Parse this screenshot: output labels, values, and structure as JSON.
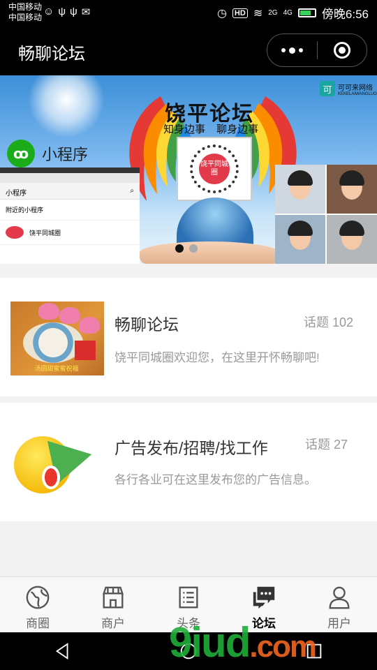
{
  "status_bar": {
    "carrier_1": "中国移动",
    "carrier_2": "中国移动",
    "hd": "HD",
    "signal_1": "2G",
    "signal_2": "4G",
    "time": "傍晚6:56"
  },
  "nav_bar": {
    "title": "畅聊论坛"
  },
  "banner": {
    "mini_program_label": "小程序",
    "title": "饶平论坛",
    "subtitle": "知身边事 聊身边事",
    "qr_center": "饶平同城圈",
    "brand": "可可来网络",
    "brand_sub": "KEKELAIWANGLUO",
    "phone": {
      "header": "小程序",
      "row_1": "附近的小程序",
      "row_2": "饶平同城圈"
    },
    "active_indicator": 0,
    "indicator_count": 2
  },
  "forums": [
    {
      "title": "畅聊论坛",
      "count": "话题 102",
      "description": "饶平同城圈欢迎您，在这里开怀畅聊吧!",
      "thumb_caption": "汤圆甜蜜蜜祝福"
    },
    {
      "title": "广告发布/招聘/找工作",
      "count": "话题 27",
      "description": "各行各业可在这里发布您的广告信息。"
    }
  ],
  "tabs": [
    {
      "label": "商圈",
      "icon": "globe-icon",
      "active": false
    },
    {
      "label": "商户",
      "icon": "shop-icon",
      "active": false
    },
    {
      "label": "头条",
      "icon": "list-icon",
      "active": false
    },
    {
      "label": "论坛",
      "icon": "chat-icon",
      "active": true
    },
    {
      "label": "用户",
      "icon": "user-icon",
      "active": false
    }
  ],
  "watermark": {
    "main": "9iud",
    "suffix": ".com"
  },
  "colors": {
    "nav_background": "#000000",
    "card_background": "#ffffff",
    "page_background": "#f2f2f2",
    "muted_text": "#999999",
    "watermark_green": "#1fae3a",
    "watermark_orange": "#f26522"
  }
}
